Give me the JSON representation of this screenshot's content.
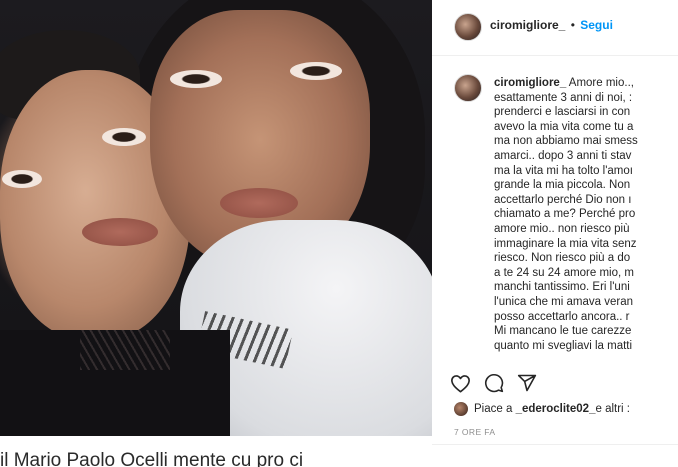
{
  "post": {
    "username": "ciromigliore_",
    "separator": "•",
    "follow_label": "Segui",
    "caption_user": "ciromigliore_",
    "caption_lines": [
      " Amore mio..,",
      "esattamente 3 anni di noi, :",
      "prenderci e lasciarsi in con",
      "avevo la mia vita come tu a",
      "ma non abbiamo mai smess",
      "amarci.. dopo 3 anni ti stav",
      "ma la vita mi ha tolto l'amoı",
      "grande la mia piccola. Non",
      "accettarlo perché Dio non ı",
      "chiamato a me? Perché pro",
      "amore mio.. non riesco più",
      "immaginare la mia vita senz",
      "riesco. Non riesco più a do",
      "a te 24 su 24 amore mio, m",
      "manchi tantissimo. Eri l'uni",
      "l'unica che mi amava veran",
      "posso accettarlo ancora.. r",
      "Mi mancano le tue carezze",
      "quanto mi svegliavi la matti"
    ],
    "likes_prefix": "Piace a ",
    "likes_user": "_ederoclite02_",
    "likes_suffix": " e altri :",
    "time_ago": "7 ORE FA"
  },
  "icons": {
    "like": "heart-icon",
    "comment": "comment-icon",
    "share": "share-icon"
  },
  "article": {
    "text": "il Mario Paolo Ocelli  mente  cu  pro  ci"
  },
  "colors": {
    "follow": "#0095f6",
    "text": "#262626",
    "muted": "#8e8e8e"
  }
}
